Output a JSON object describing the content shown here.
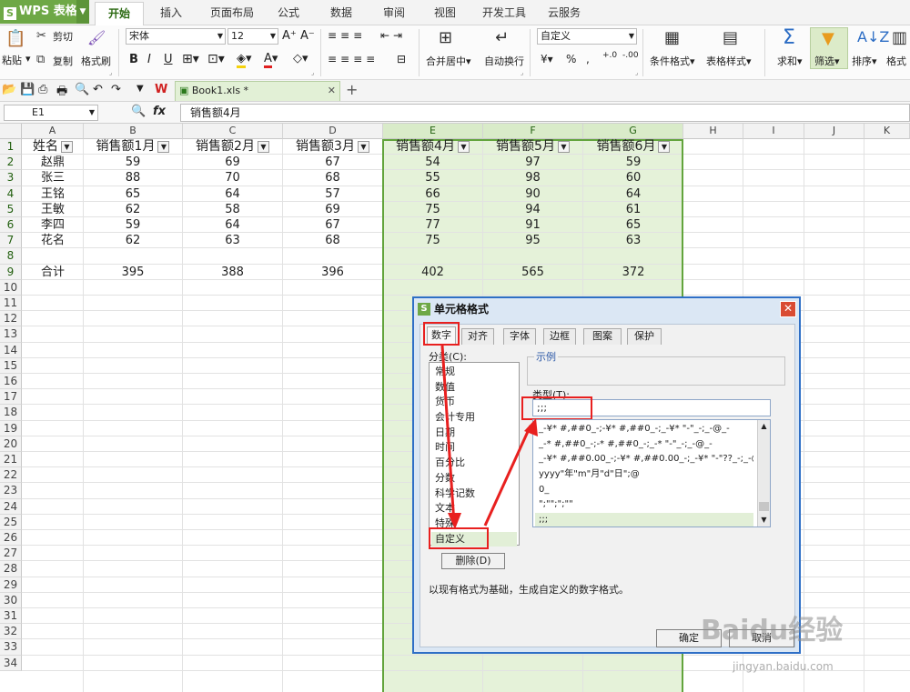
{
  "app": {
    "name": "WPS 表格",
    "accent": "#6ea846"
  },
  "menu": {
    "tabs": [
      "开始",
      "插入",
      "页面布局",
      "公式",
      "数据",
      "审阅",
      "视图",
      "开发工具",
      "云服务"
    ],
    "active": "开始"
  },
  "ribbon": {
    "cut": "剪切",
    "paste": "粘贴",
    "copy": "复制",
    "format_painter": "格式刷",
    "font_name": "宋体",
    "font_size": "12",
    "merge_center": "合并居中",
    "wrap": "自动换行",
    "number_format": "自定义",
    "percent": "%",
    "conditional_format": "条件格式",
    "table_style": "表格样式",
    "sum": "求和",
    "filter": "筛选",
    "sort": "排序",
    "format": "格式"
  },
  "document": {
    "tab_name": "Book1.xls *"
  },
  "formula_bar": {
    "cell_ref": "E1",
    "fx": "fx",
    "content": "销售额4月"
  },
  "sheet": {
    "columns": [
      "A",
      "B",
      "C",
      "D",
      "E",
      "F",
      "G",
      "H",
      "I",
      "J",
      "K"
    ],
    "selected_columns": [
      "E",
      "F",
      "G"
    ],
    "rows": [
      "1",
      "2",
      "3",
      "4",
      "5",
      "6",
      "7",
      "8",
      "9",
      "10",
      "11",
      "12",
      "13",
      "14",
      "15",
      "16",
      "17",
      "18",
      "19",
      "20",
      "21",
      "22",
      "23",
      "24",
      "25",
      "26",
      "27",
      "28",
      "29",
      "30",
      "31",
      "32",
      "33",
      "34"
    ],
    "headers": [
      "姓名",
      "销售额1月",
      "销售额2月",
      "销售额3月",
      "销售额4月",
      "销售额5月",
      "销售额6月"
    ],
    "data": [
      [
        "赵鼎",
        "59",
        "69",
        "67",
        "54",
        "97",
        "59"
      ],
      [
        "张三",
        "88",
        "70",
        "68",
        "55",
        "98",
        "60"
      ],
      [
        "王铭",
        "65",
        "64",
        "57",
        "66",
        "90",
        "64"
      ],
      [
        "王敏",
        "62",
        "58",
        "69",
        "75",
        "94",
        "61"
      ],
      [
        "李四",
        "59",
        "64",
        "67",
        "77",
        "91",
        "65"
      ],
      [
        "花名",
        "62",
        "63",
        "68",
        "75",
        "95",
        "63"
      ]
    ],
    "total_row": [
      "合计",
      "395",
      "388",
      "396",
      "402",
      "565",
      "372"
    ]
  },
  "dialog": {
    "title": "单元格格式",
    "tabs": [
      "数字",
      "对齐",
      "字体",
      "边框",
      "图案",
      "保护"
    ],
    "active_tab": "数字",
    "category_label": "分类(C):",
    "categories": [
      "常规",
      "数值",
      "货币",
      "会计专用",
      "日期",
      "时间",
      "百分比",
      "分数",
      "科学记数",
      "文本",
      "特殊",
      "自定义"
    ],
    "selected_category": "自定义",
    "sample_label": "示例",
    "type_label": "类型(T):",
    "type_value": ";;;",
    "formats": [
      "_-¥* #,##0_-;-¥* #,##0_-;_-¥* \"-\"_-;_-@_-",
      "_-* #,##0_-;-* #,##0_-;_-* \"-\"_-;_-@_-",
      "_-¥* #,##0.00_-;-¥* #,##0.00_-;_-¥* \"-\"??_-;_-@_-",
      "yyyy\"年\"m\"月\"d\"日\";@",
      "0_",
      "\";\"\";\";\"\"",
      ";;;"
    ],
    "delete_button": "删除(D)",
    "description": "以现有格式为基础，生成自定义的数字格式。",
    "ok_button": "确定",
    "cancel_button": "取消"
  },
  "watermark": {
    "text": "Baidu经验",
    "url": "jingyan.baidu.com"
  }
}
